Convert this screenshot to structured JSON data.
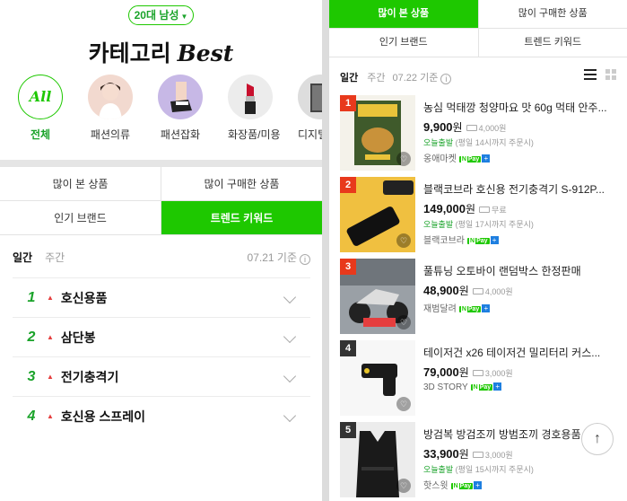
{
  "left": {
    "filter_label": "20대 남성",
    "title_korean": "카테고리",
    "title_english": "Best",
    "categories": [
      {
        "label": "전체",
        "icon": "All"
      },
      {
        "label": "패션의류",
        "icon": "model-photo"
      },
      {
        "label": "패션잡화",
        "icon": "shoe-photo"
      },
      {
        "label": "화장품/미용",
        "icon": "lipstick-photo"
      },
      {
        "label": "디지털/",
        "icon": "device-photo"
      }
    ],
    "tabs": [
      "많이 본 상품",
      "많이 구매한 상품",
      "인기 브랜드",
      "트렌드 키워드"
    ],
    "period": {
      "daily": "일간",
      "weekly": "주간",
      "date": "07.21 기준"
    },
    "keywords": [
      {
        "rank": "1",
        "name": "호신용품"
      },
      {
        "rank": "2",
        "name": "삼단봉"
      },
      {
        "rank": "3",
        "name": "전기충격기"
      },
      {
        "rank": "4",
        "name": "호신용 스프레이"
      }
    ]
  },
  "right": {
    "tabs": [
      "많이 본 상품",
      "많이 구매한 상품",
      "인기 브랜드",
      "트렌드 키워드"
    ],
    "period": {
      "daily": "일간",
      "weekly": "주간",
      "date": "07.22 기준"
    },
    "products": [
      {
        "rank": "1",
        "title": "농심 먹태깡 청양마요 맛 60g 먹태 안주...",
        "price": "9,900",
        "won": "원",
        "ship": "4,000원",
        "today": "오늘출발",
        "today_note": "(평일 14시까지 주문시)",
        "seller": "옹애마켓",
        "npay": "Pay"
      },
      {
        "rank": "2",
        "title": "블랙코브라 호신용 전기충격기 S-912P...",
        "price": "149,000",
        "won": "원",
        "ship": "무료",
        "today": "오늘출발",
        "today_note": "(평일 17시까지 주문시)",
        "seller": "블랙코브라",
        "npay": "Pay"
      },
      {
        "rank": "3",
        "title": "풀튜닝 오토바이 랜덤박스 한정판매",
        "price": "48,900",
        "won": "원",
        "ship": "4,000원",
        "today": "",
        "today_note": "",
        "seller": "재범달려",
        "npay": "Pay"
      },
      {
        "rank": "4",
        "title": "테이저건 x26 테이저건 밀리터리 커스...",
        "price": "79,000",
        "won": "원",
        "ship": "3,000원",
        "today": "",
        "today_note": "",
        "seller": "3D STORY",
        "npay": "Pay"
      },
      {
        "rank": "5",
        "title": "방검복 방검조끼 방범조끼 경호용품 호...",
        "price": "33,900",
        "won": "원",
        "ship": "3,000원",
        "today": "오늘출발",
        "today_note": "(평일 15시까지 주문시)",
        "seller": "핫스윗",
        "npay": "Pay"
      }
    ]
  },
  "colors": {
    "accent": "#1ec800",
    "rank_up": "#e53e3e",
    "badge_top3": "#e8391c"
  }
}
